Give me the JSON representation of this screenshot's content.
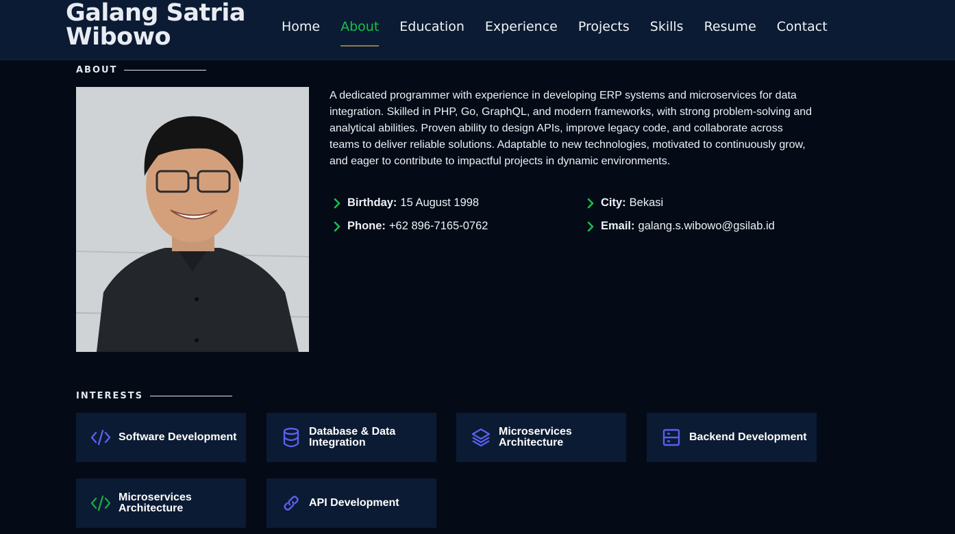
{
  "header": {
    "brand": "Galang Satria Wibowo",
    "nav": [
      {
        "label": "Home",
        "active": false
      },
      {
        "label": "About",
        "active": true
      },
      {
        "label": "Education",
        "active": false
      },
      {
        "label": "Experience",
        "active": false
      },
      {
        "label": "Projects",
        "active": false
      },
      {
        "label": "Skills",
        "active": false
      },
      {
        "label": "Resume",
        "active": false
      },
      {
        "label": "Contact",
        "active": false
      }
    ]
  },
  "about": {
    "title": "ABOUT",
    "bio": "A dedicated programmer with experience in developing ERP systems and microservices for data integration. Skilled in PHP, Go, GraphQL, and modern frameworks, with strong problem-solving and analytical abilities. Proven ability to design APIs, improve legacy code, and collaborate across teams to deliver reliable solutions. Adaptable to new technologies, motivated to continuously grow, and eager to contribute to impactful projects in dynamic environments.",
    "facts": {
      "birthday": {
        "label": "Birthday:",
        "value": "15 August 1998"
      },
      "city": {
        "label": "City:",
        "value": "Bekasi"
      },
      "phone": {
        "label": "Phone:",
        "value": "+62 896-7165-0762"
      },
      "email": {
        "label": "Email:",
        "value": "galang.s.wibowo@gsilab.id"
      }
    }
  },
  "interests": {
    "title": "INTERESTS",
    "items": [
      {
        "label": "Software Development",
        "icon": "code-icon",
        "color": "#5b5ff0"
      },
      {
        "label": "Database & Data Integration",
        "icon": "database-icon",
        "color": "#5b5ff0"
      },
      {
        "label": "Microservices Architecture",
        "icon": "layers-icon",
        "color": "#5b5ff0"
      },
      {
        "label": "Backend Development",
        "icon": "server-icon",
        "color": "#5b5ff0"
      },
      {
        "label": "Microservices Architecture",
        "icon": "code-icon",
        "color": "#17a745"
      },
      {
        "label": "API Development",
        "icon": "link-icon",
        "color": "#5b5ff0"
      }
    ]
  },
  "colors": {
    "accent": "#17c04a",
    "background": "#040b17",
    "header": "#0b1b33",
    "card": "#0b1b33"
  }
}
